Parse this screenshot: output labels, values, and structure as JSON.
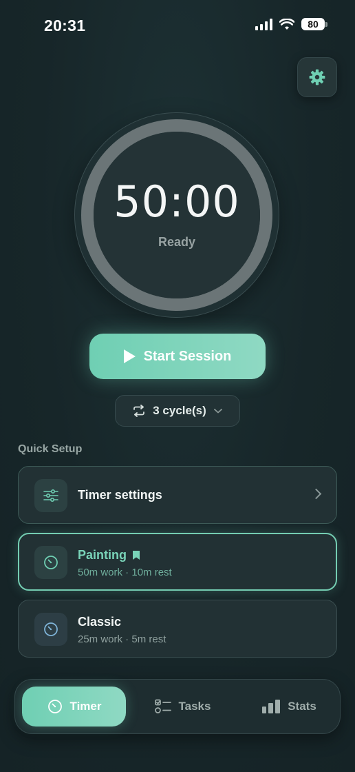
{
  "status_bar": {
    "time": "20:31",
    "battery": "80"
  },
  "timer": {
    "time": "50:00",
    "state": "Ready"
  },
  "start_button": {
    "label": "Start Session"
  },
  "cycles": {
    "label": "3 cycle(s)"
  },
  "quick_setup": {
    "title": "Quick Setup",
    "timer_settings": {
      "label": "Timer settings"
    },
    "presets": [
      {
        "name": "Painting",
        "detail": "50m work · 10m rest",
        "selected": true
      },
      {
        "name": "Classic",
        "detail": "25m work · 5m rest",
        "selected": false
      }
    ]
  },
  "tabs": [
    {
      "label": "Timer",
      "icon": "timer-icon",
      "active": true
    },
    {
      "label": "Tasks",
      "icon": "tasks-icon",
      "active": false
    },
    {
      "label": "Stats",
      "icon": "stats-icon",
      "active": false
    }
  ],
  "colors": {
    "accent": "#6fcfb3",
    "background": "#18282b",
    "ring": "#6b7577"
  }
}
